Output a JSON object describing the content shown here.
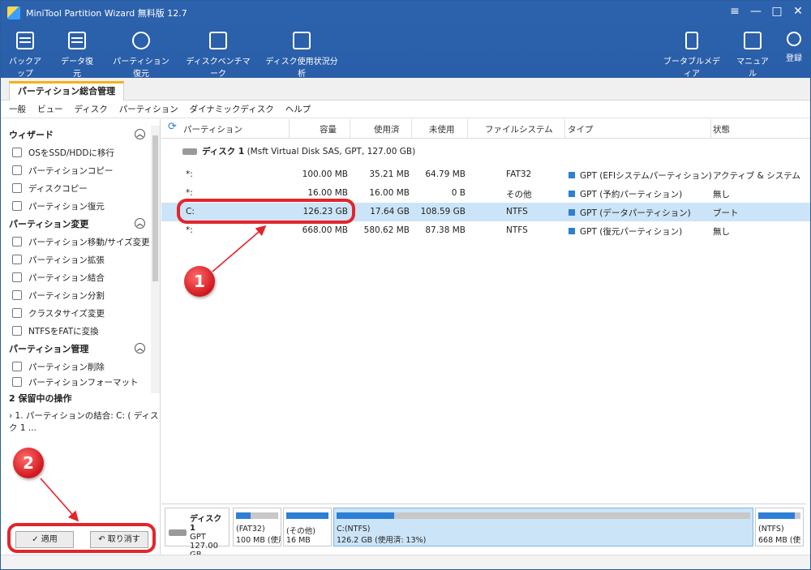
{
  "window": {
    "title": "MiniTool Partition Wizard 無料版 12.7",
    "controls": [
      "≡",
      "—",
      "□",
      "✕"
    ]
  },
  "toolbar": {
    "left": [
      {
        "label": "バックアップ",
        "icon": "backup-icon"
      },
      {
        "label": "データ復元",
        "icon": "data-recovery-icon"
      },
      {
        "label": "パーティション復元",
        "icon": "partition-recovery-icon"
      },
      {
        "label": "ディスクベンチマーク",
        "icon": "disk-benchmark-icon"
      },
      {
        "label": "ディスク使用状況分析",
        "icon": "space-analyzer-icon"
      }
    ],
    "right": [
      {
        "label": "ブータブルメディア",
        "icon": "bootable-media-icon"
      },
      {
        "label": "マニュアル",
        "icon": "manual-icon"
      },
      {
        "label": "登録",
        "icon": "register-icon"
      }
    ]
  },
  "tab": {
    "label": "パーティション総合管理"
  },
  "menu": [
    "一般",
    "ビュー",
    "ディスク",
    "パーティション",
    "ダイナミックディスク",
    "ヘルプ"
  ],
  "sidebar": {
    "groups": [
      {
        "title": "ウィザード",
        "items": [
          "OSをSSD/HDDに移行",
          "パーティションコピー",
          "ディスクコピー",
          "パーティション復元"
        ]
      },
      {
        "title": "パーティション変更",
        "items": [
          "パーティション移動/サイズ変更",
          "パーティション拡張",
          "パーティション結合",
          "パーティション分割",
          "クラスタサイズ変更",
          "NTFSをFATに変換"
        ]
      },
      {
        "title": "パーティション管理",
        "items": [
          "パーティション削除",
          "パーティションフォーマット"
        ]
      }
    ],
    "pending_title": "2 保留中の操作",
    "pending_item": "1. パーティションの結合: C: ( ディスク 1 ...",
    "apply_label": "✓ 適用",
    "undo_label": "↶ 取り消す"
  },
  "table": {
    "headers": [
      "パーティション",
      "容量",
      "使用済",
      "未使用",
      "ファイルシステム",
      "タイプ",
      "状態"
    ],
    "disk_label": "ディスク 1",
    "disk_detail": "(Msft Virtual Disk SAS, GPT, 127.00 GB)",
    "rows": [
      {
        "name": "*:",
        "capacity": "100.00 MB",
        "used": "35.21 MB",
        "unused": "64.79 MB",
        "fs": "FAT32",
        "type": "GPT (EFIシステムパーティション)",
        "status": "アクティブ & システム"
      },
      {
        "name": "*:",
        "capacity": "16.00 MB",
        "used": "16.00 MB",
        "unused": "0 B",
        "fs": "その他",
        "type": "GPT (予約パーティション)",
        "status": "無し"
      },
      {
        "name": "C:",
        "capacity": "126.23 GB",
        "used": "17.64 GB",
        "unused": "108.59 GB",
        "fs": "NTFS",
        "type": "GPT (データパーティション)",
        "status": "ブート"
      },
      {
        "name": "*:",
        "capacity": "668.00 MB",
        "used": "580.62 MB",
        "unused": "87.38 MB",
        "fs": "NTFS",
        "type": "GPT (復元パーティション)",
        "status": "無し"
      }
    ]
  },
  "diskmap": {
    "disk": {
      "name": "ディスク 1",
      "scheme": "GPT",
      "size": "127.00 GB"
    },
    "segments": [
      {
        "line1": "(FAT32)",
        "line2": "100 MB (使用",
        "fill": 0.35
      },
      {
        "line1": "(その他)",
        "line2": "16 MB",
        "fill": 1.0
      },
      {
        "line1": "C:(NTFS)",
        "line2": "126.2 GB (使用済: 13%)",
        "fill": 0.14
      },
      {
        "line1": "(NTFS)",
        "line2": "668 MB (使",
        "fill": 0.87
      }
    ]
  },
  "annotations": {
    "badge1": "1",
    "badge2": "2",
    "color": "#e3252b"
  }
}
